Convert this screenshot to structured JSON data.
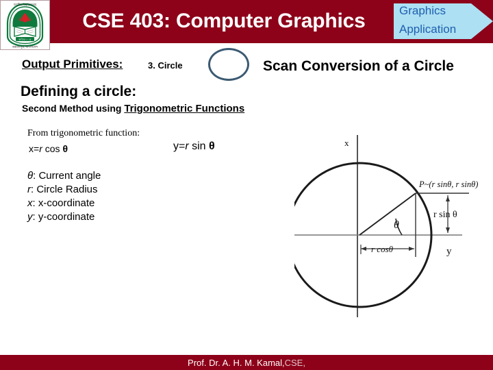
{
  "header": {
    "title": "CSE 403: Computer Graphics",
    "bar_color": "#8d0119",
    "logo_name": "university-crest-logo"
  },
  "banner": {
    "line1": "Graphics",
    "line2": "Application",
    "fill_color": "#ace0f2",
    "text_color": "#1f5fb0"
  },
  "content": {
    "output_primitives_label": "Output Primitives:",
    "circle_item": "3. Circle",
    "section_heading": "Scan Conversion of a Circle",
    "defining_heading": "Defining a circle:",
    "second_method_prefix": "Second Method using ",
    "second_method_emphasis": "Trigonometric Functions",
    "from_trig_label": "From trigonometric function:",
    "equation_x": "x=r cos θ",
    "equation_y": "y=r sin θ",
    "definitions": [
      "θ: Current angle",
      "r: Circle Radius",
      "x: x-coordinate",
      "y: y-coordinate"
    ]
  },
  "diagram": {
    "name": "circle-trigonometry-diagram",
    "axis_label_x": "x",
    "axis_label_y": "y",
    "point_label": "P~(r sinθ, r sinθ)",
    "vertical_label": "r sin θ",
    "horizontal_label": "r cosθ",
    "angle_label": "θ"
  },
  "footer": {
    "text_main": "Prof. Dr. A. H. M. Kamal,",
    "text_dim": " CSE,",
    "bar_color": "#8d0119"
  }
}
